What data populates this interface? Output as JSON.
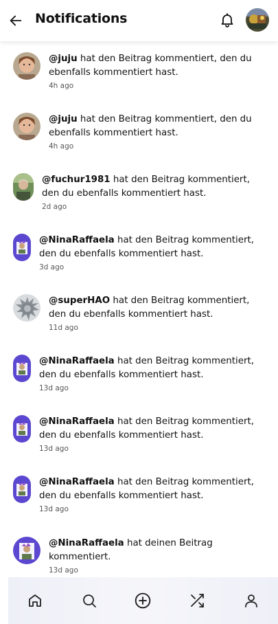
{
  "header": {
    "title": "Notifications",
    "back_icon": "arrow-left-icon",
    "bell_icon": "bell-icon"
  },
  "notifications": [
    {
      "user": "@juju",
      "message": " hat den Beitrag kommentiert, den du ebenfalls kommentiert hast.",
      "time": "4h ago"
    },
    {
      "user": "@juju",
      "message": " hat den Beitrag kommentiert, den du ebenfalls kommentiert hast.",
      "time": "4h ago"
    },
    {
      "user": "@fuchur1981",
      "message": " hat den Beitrag kommentiert, den du ebenfalls kommentiert hast.",
      "time": "2d ago"
    },
    {
      "user": "@NinaRaffaela",
      "message": " hat den Beitrag kommentiert, den du ebenfalls kommentiert hast.",
      "time": "3d ago"
    },
    {
      "user": "@superHAO",
      "message": " hat den Beitrag kommentiert, den du ebenfalls kommentiert hast.",
      "time": "11d ago"
    },
    {
      "user": "@NinaRaffaela",
      "message": " hat den Beitrag kommentiert, den du ebenfalls kommentiert hast.",
      "time": "13d ago"
    },
    {
      "user": "@NinaRaffaela",
      "message": " hat den Beitrag kommentiert, den du ebenfalls kommentiert hast.",
      "time": "13d ago"
    },
    {
      "user": "@NinaRaffaela",
      "message": " hat den Beitrag kommentiert, den du ebenfalls kommentiert hast.",
      "time": "13d ago"
    },
    {
      "user": "@NinaRaffaela",
      "message": " hat deinen Beitrag kommentiert.",
      "time": "13d ago"
    }
  ],
  "bottom_nav": {
    "items": [
      "home-icon",
      "search-icon",
      "plus-circle-icon",
      "shuffle-icon",
      "profile-icon"
    ]
  },
  "colors": {
    "accent": "#6a4fd8",
    "text": "#111111",
    "muted": "#555555",
    "nav_bg": "#eef0f8"
  }
}
